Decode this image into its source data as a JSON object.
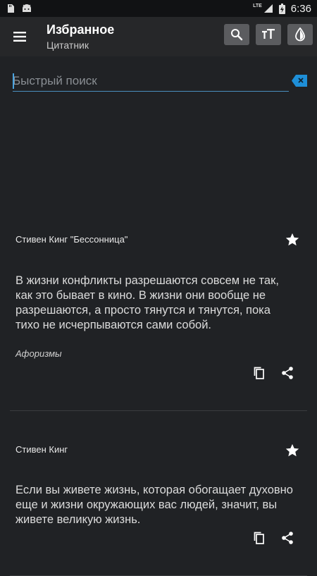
{
  "status": {
    "time": "6:36",
    "network": "LTE"
  },
  "appbar": {
    "title": "Избранное",
    "subtitle": "Цитатник"
  },
  "search": {
    "placeholder": "Быстрый поиск",
    "value": ""
  },
  "quotes": [
    {
      "author": "Стивен Кинг \"Бессонница\"",
      "text": "В жизни конфликты разрешаются совсем не так, как это бывает в кино. В жизни они вообще не разрешаются, а просто тянутся и тянутся, пока тихо не исчерпываются сами собой.",
      "category": "Афоризмы"
    },
    {
      "author": "Стивен Кинг",
      "text": "Если вы живете жизнь, которая обогащает духовно еще и жизни окружающих вас людей, значит, вы живете великую жизнь."
    }
  ],
  "colors": {
    "background": "#202225",
    "appbar": "#262729",
    "accent": "#4aa3df",
    "button": "#5b5c5f"
  },
  "icons": [
    "menu-icon",
    "search-icon",
    "text-size-icon",
    "theme-drop-icon",
    "backspace-clear-icon",
    "star-icon",
    "copy-icon",
    "share-icon"
  ]
}
